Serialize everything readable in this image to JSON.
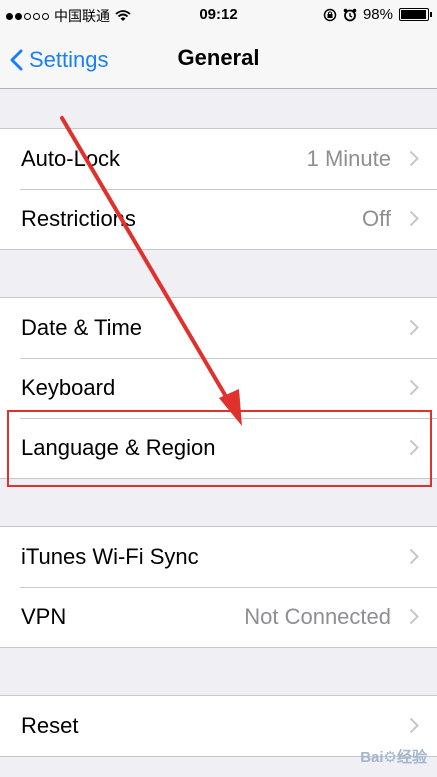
{
  "status_bar": {
    "carrier": "中国联通",
    "time": "09:12",
    "battery": "98%",
    "battery_level": 0.98,
    "signal_bars": 2,
    "icons": [
      "wifi-icon",
      "rotation-lock-icon",
      "alarm-icon",
      "battery-icon"
    ]
  },
  "nav": {
    "back_label": "Settings",
    "title": "General"
  },
  "groups": [
    {
      "rows": [
        {
          "label": "Auto-Lock",
          "value": "1 Minute"
        },
        {
          "label": "Restrictions",
          "value": "Off"
        }
      ]
    },
    {
      "rows": [
        {
          "label": "Date & Time",
          "value": ""
        },
        {
          "label": "Keyboard",
          "value": ""
        },
        {
          "label": "Language & Region",
          "value": ""
        }
      ]
    },
    {
      "rows": [
        {
          "label": "iTunes Wi-Fi Sync",
          "value": ""
        },
        {
          "label": "VPN",
          "value": "Not Connected"
        }
      ]
    },
    {
      "rows": [
        {
          "label": "Reset",
          "value": ""
        }
      ]
    }
  ],
  "annotation": {
    "highlighted_row": "Language & Region",
    "color": "#e0312d"
  },
  "colors": {
    "accent": "#1a7ff7",
    "background": "#efeff4",
    "secondary_text": "#8e8e93"
  },
  "watermark": "Bai⚙经验"
}
